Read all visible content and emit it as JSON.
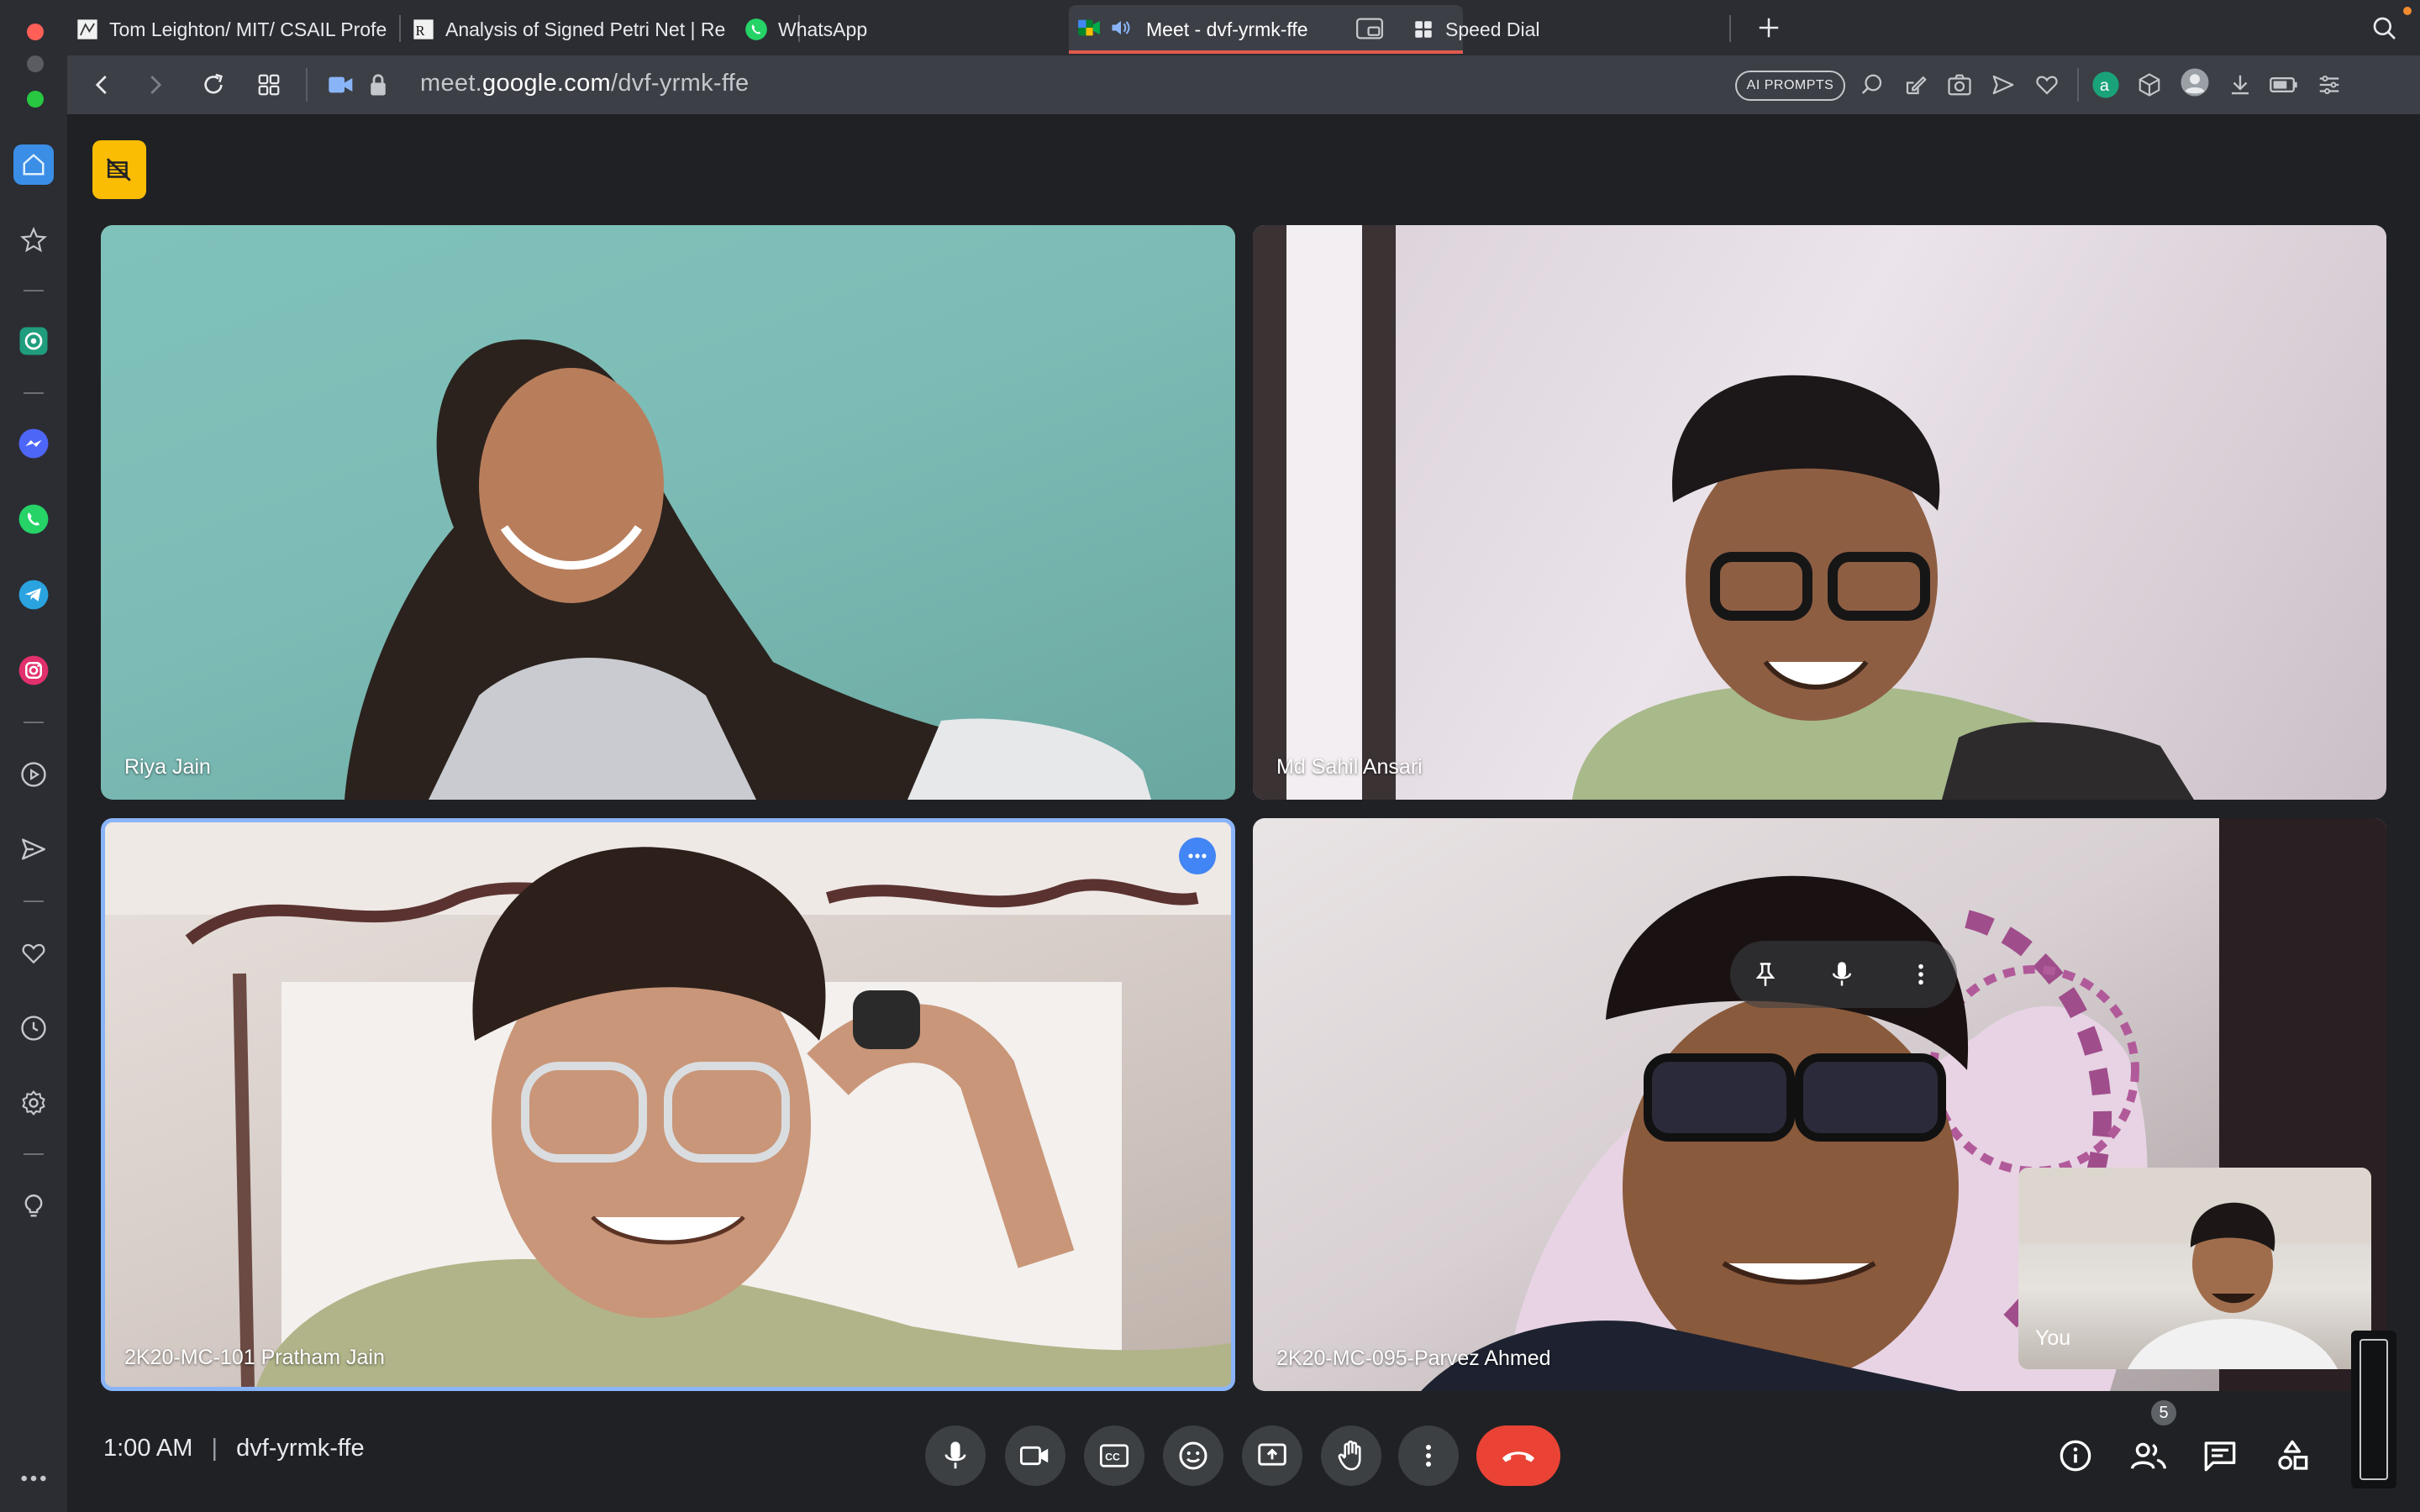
{
  "browser": {
    "tabs": [
      {
        "title": "Tom Leighton/ MIT/ CSAIL Profe",
        "active": false
      },
      {
        "title": "Analysis of Signed Petri Net | Re",
        "active": false
      },
      {
        "title": "WhatsApp",
        "active": false
      },
      {
        "title": "Meet - dvf-yrmk-ffe",
        "active": true
      },
      {
        "title": "Speed Dial",
        "active": false
      }
    ],
    "url_prefix": "meet.",
    "url_domain": "google.com",
    "url_path": "/dvf-yrmk-ffe",
    "ai_prompts_label": "AI PROMPTS"
  },
  "sidebar": {
    "icons": [
      "home-icon",
      "bookmark-star-icon",
      "chatgpt-icon",
      "messenger-icon",
      "whatsapp-icon",
      "telegram-icon",
      "instagram-icon",
      "player-icon",
      "send-icon",
      "heart-icon",
      "history-icon",
      "settings-icon",
      "bulb-icon",
      "more-icon"
    ]
  },
  "meeting": {
    "participants": [
      {
        "name": "Riya Jain"
      },
      {
        "name": "Md Sahil Ansari"
      },
      {
        "name": "2K20-MC-101 Pratham Jain"
      },
      {
        "name": "2K20-MC-095-Parvez Ahmed"
      }
    ],
    "self_label": "You",
    "time": "1:00 AM",
    "separator": "|",
    "code": "dvf-yrmk-ffe",
    "participant_count": "5"
  },
  "colors": {
    "end_call": "#ea4335",
    "active_speaker_border": "#8ab4f8",
    "accent_blue": "#4285f4",
    "tab_indicator": "#e05a4d"
  }
}
